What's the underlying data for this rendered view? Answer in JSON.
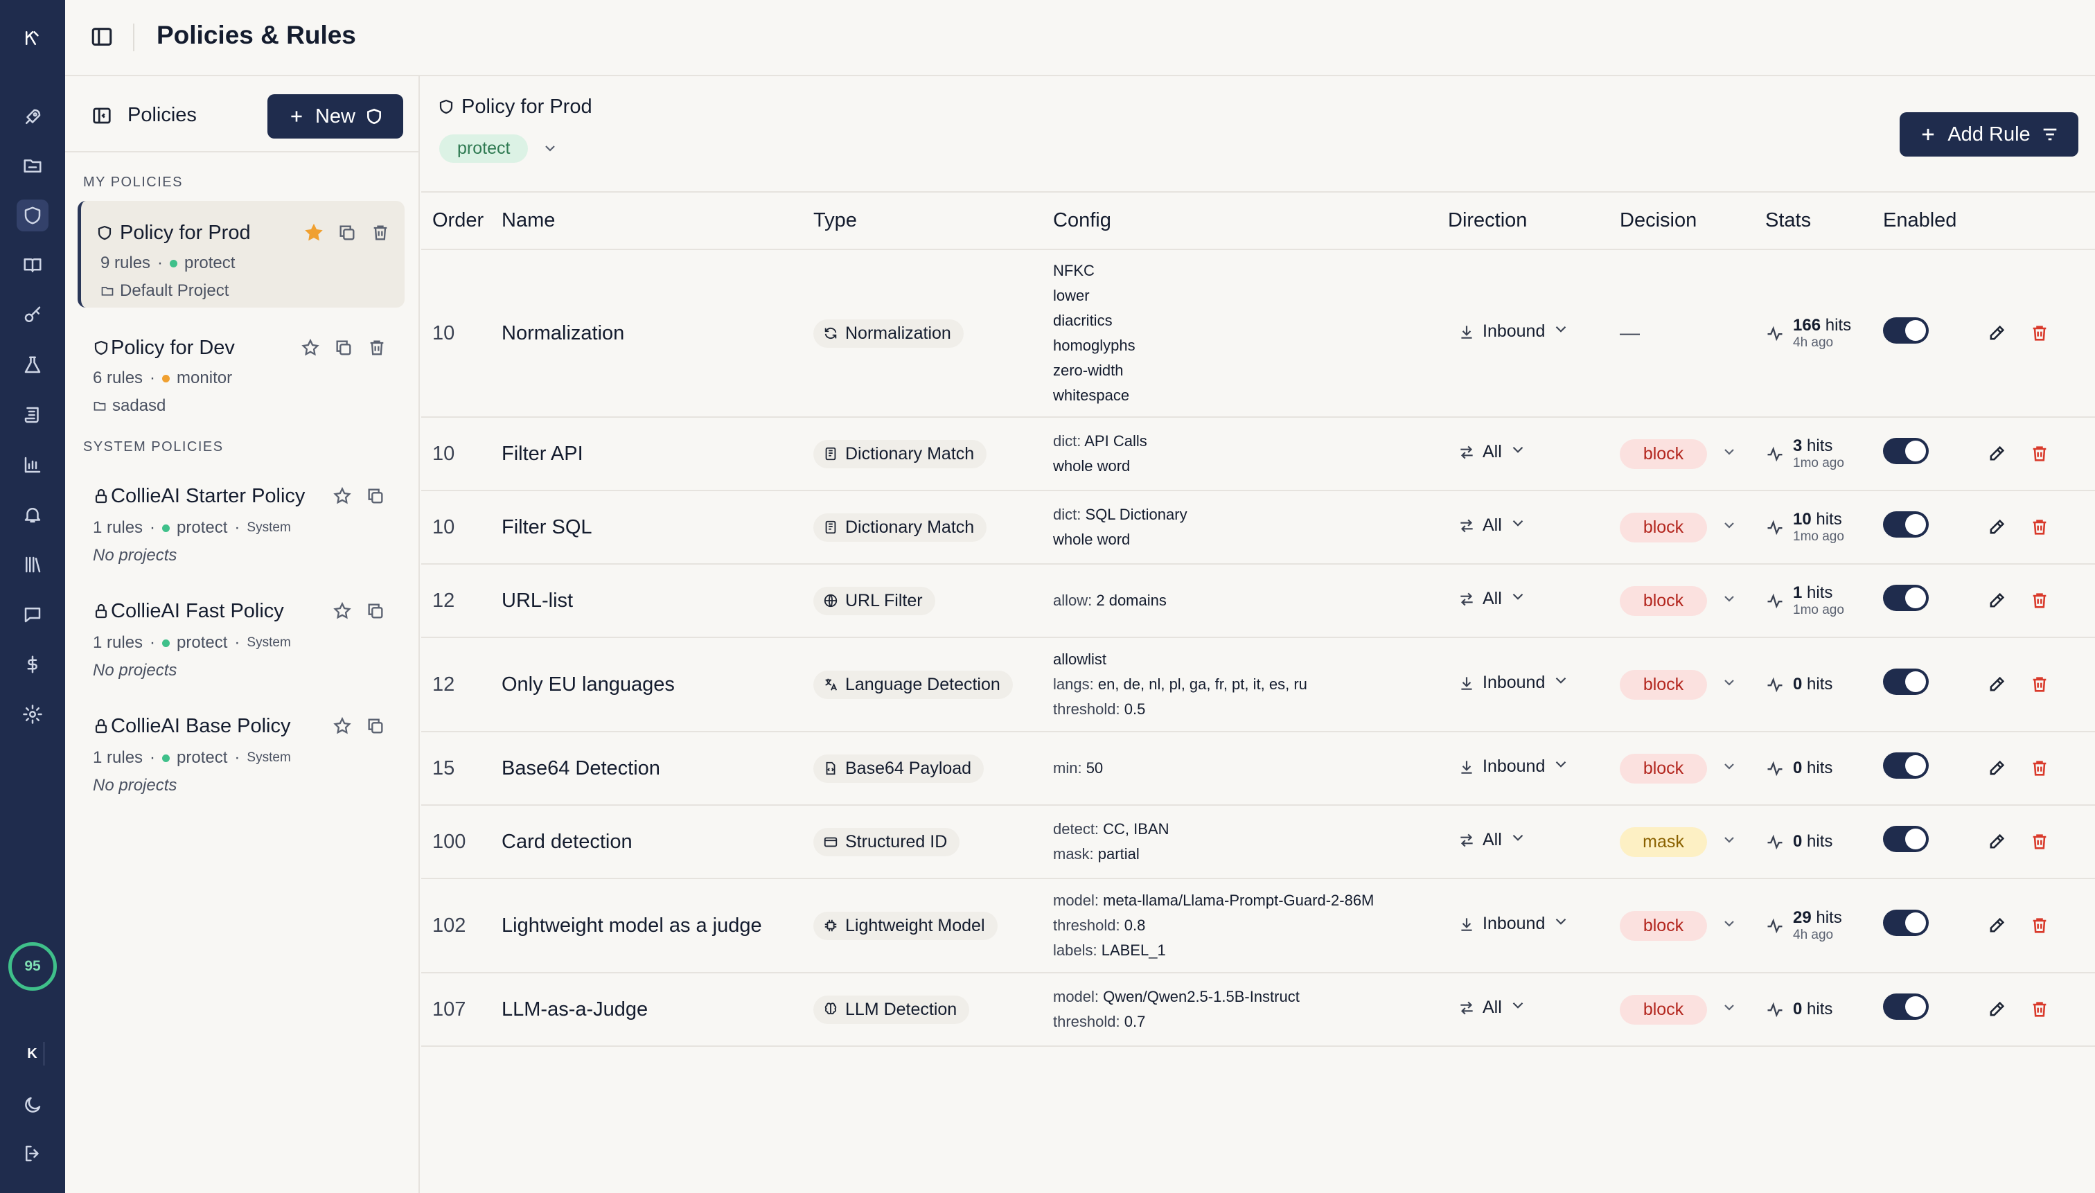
{
  "app": {
    "page_title": "Policies & Rules"
  },
  "sidebar": {
    "header": "Policies",
    "new_label": "New",
    "my_section": "MY POLICIES",
    "system_section": "SYSTEM POLICIES",
    "my_policies": [
      {
        "name": "Policy for Prod",
        "rules": "9 rules",
        "mode": "protect",
        "project": "Default Project",
        "starred": true
      },
      {
        "name": "Policy for Dev",
        "rules": "6 rules",
        "mode": "monitor",
        "project": "sadasd",
        "starred": false
      }
    ],
    "system_policies": [
      {
        "name": "CollieAI Starter Policy",
        "rules": "1 rules",
        "mode": "protect",
        "badge": "System",
        "projects": "No projects"
      },
      {
        "name": "CollieAI Fast Policy",
        "rules": "1 rules",
        "mode": "protect",
        "badge": "System",
        "projects": "No projects"
      },
      {
        "name": "CollieAI Base Policy",
        "rules": "1 rules",
        "mode": "protect",
        "badge": "System",
        "projects": "No projects"
      }
    ]
  },
  "rail": {
    "score": "95",
    "user_initial": "K"
  },
  "policy": {
    "name": "Policy for Prod",
    "mode": "protect",
    "add_rule_label": "Add Rule"
  },
  "table": {
    "headers": {
      "order": "Order",
      "name": "Name",
      "type": "Type",
      "config": "Config",
      "direction": "Direction",
      "decision": "Decision",
      "stats": "Stats",
      "enabled": "Enabled"
    },
    "rows": [
      {
        "order": "10",
        "name": "Normalization",
        "type": "Normalization",
        "type_icon": "refresh-icon",
        "config": [
          {
            "k": "",
            "v": "NFKC"
          },
          {
            "k": "",
            "v": "lower"
          },
          {
            "k": "",
            "v": "diacritics"
          },
          {
            "k": "",
            "v": "homoglyphs"
          },
          {
            "k": "",
            "v": "zero-width"
          },
          {
            "k": "",
            "v": "whitespace"
          }
        ],
        "direction": "Inbound",
        "decision": "—",
        "hits": "166",
        "hits_label": "hits",
        "ago": "4h ago",
        "enabled": true
      },
      {
        "order": "10",
        "name": "Filter API",
        "type": "Dictionary Match",
        "type_icon": "book-icon",
        "config": [
          {
            "k": "dict: ",
            "v": "API Calls"
          },
          {
            "k": "",
            "v": "whole word"
          }
        ],
        "direction": "All",
        "decision": "block",
        "hits": "3",
        "hits_label": "hits",
        "ago": "1mo ago",
        "enabled": true
      },
      {
        "order": "10",
        "name": "Filter SQL",
        "type": "Dictionary Match",
        "type_icon": "book-icon",
        "config": [
          {
            "k": "dict: ",
            "v": "SQL Dictionary"
          },
          {
            "k": "",
            "v": "whole word"
          }
        ],
        "direction": "All",
        "decision": "block",
        "hits": "10",
        "hits_label": "hits",
        "ago": "1mo ago",
        "enabled": true
      },
      {
        "order": "12",
        "name": "URL-list",
        "type": "URL Filter",
        "type_icon": "globe-icon",
        "config": [
          {
            "k": "allow: ",
            "v": "2 domains"
          }
        ],
        "direction": "All",
        "decision": "block",
        "hits": "1",
        "hits_label": "hits",
        "ago": "1mo ago",
        "enabled": true
      },
      {
        "order": "12",
        "name": "Only EU languages",
        "type": "Language Detection",
        "type_icon": "translate-icon",
        "config": [
          {
            "k": "",
            "v": "allowlist"
          },
          {
            "k": "langs: ",
            "v": "en, de, nl, pl, ga, fr, pt, it, es, ru"
          },
          {
            "k": "threshold: ",
            "v": "0.5"
          }
        ],
        "direction": "Inbound",
        "decision": "block",
        "hits": "0",
        "hits_label": "hits",
        "ago": "",
        "enabled": true
      },
      {
        "order": "15",
        "name": "Base64 Detection",
        "type": "Base64 Payload",
        "type_icon": "file-code-icon",
        "config": [
          {
            "k": "min: ",
            "v": "50"
          }
        ],
        "direction": "Inbound",
        "decision": "block",
        "hits": "0",
        "hits_label": "hits",
        "ago": "",
        "enabled": true
      },
      {
        "order": "100",
        "name": "Card detection",
        "type": "Structured ID",
        "type_icon": "card-icon",
        "config": [
          {
            "k": "detect: ",
            "v": "CC, IBAN"
          },
          {
            "k": "mask: ",
            "v": "partial"
          }
        ],
        "direction": "All",
        "decision": "mask",
        "hits": "0",
        "hits_label": "hits",
        "ago": "",
        "enabled": true
      },
      {
        "order": "102",
        "name": "Lightweight model as a judge",
        "type": "Lightweight Model",
        "type_icon": "chip-icon",
        "config": [
          {
            "k": "model: ",
            "v": "meta-llama/Llama-Prompt-Guard-2-86M"
          },
          {
            "k": "threshold: ",
            "v": "0.8"
          },
          {
            "k": "labels: ",
            "v": "LABEL_1"
          }
        ],
        "direction": "Inbound",
        "decision": "block",
        "hits": "29",
        "hits_label": "hits",
        "ago": "4h ago",
        "enabled": true
      },
      {
        "order": "107",
        "name": "LLM-as-a-Judge",
        "type": "LLM Detection",
        "type_icon": "brain-icon",
        "config": [
          {
            "k": "model: ",
            "v": "Qwen/Qwen2.5-1.5B-Instruct"
          },
          {
            "k": "threshold: ",
            "v": "0.7"
          }
        ],
        "direction": "All",
        "decision": "block",
        "hits": "0",
        "hits_label": "hits",
        "ago": "",
        "enabled": true
      }
    ]
  },
  "colors": {
    "navy": "#1f2c4d",
    "protect": "#3fc08a",
    "monitor": "#f0a030",
    "star": "#f0a030",
    "delete": "#d93a2b"
  }
}
